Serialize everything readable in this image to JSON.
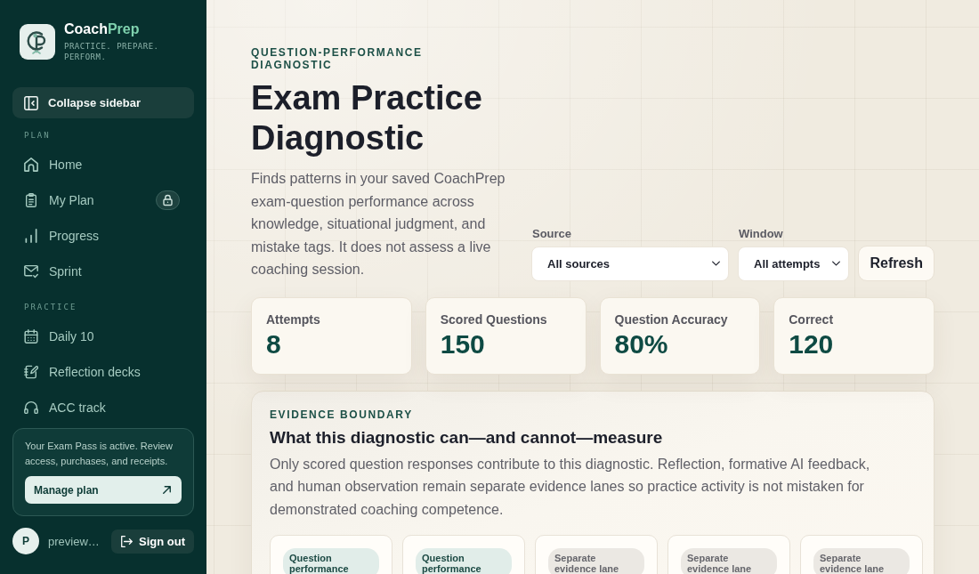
{
  "sidebar": {
    "brand": {
      "name_start": "Coach",
      "name_accent": "Prep",
      "tagline": "PRACTICE. PREPARE. PERFORM."
    },
    "collapse_button": {
      "label": "Collapse sidebar"
    },
    "sections": [
      {
        "heading": "PLAN",
        "items": [
          {
            "label": "Home",
            "selected": false,
            "locked": false
          },
          {
            "label": "My Plan",
            "selected": false,
            "locked": true
          },
          {
            "label": "Progress",
            "selected": false,
            "locked": false
          },
          {
            "label": "Sprint",
            "selected": false,
            "locked": false
          }
        ]
      },
      {
        "heading": "PRACTICE",
        "items": [
          {
            "label": "Daily 10",
            "selected": false,
            "locked": false
          },
          {
            "label": "Reflection decks",
            "selected": false,
            "locked": false
          },
          {
            "label": "ACC track",
            "selected": false,
            "locked": false
          }
        ]
      }
    ],
    "plan_card": {
      "text": "Your Exam Pass is active. Review access, purchases, and receipts.",
      "button": "Manage plan"
    },
    "user": {
      "avatar": "P",
      "name": "preview…"
    },
    "sign_out": "Sign out"
  },
  "header": {
    "eyebrow": "QUESTION-PERFORMANCE DIAGNOSTIC",
    "title": "Exam Practice Diagnostic",
    "description": "Finds patterns in your saved CoachPrep exam-question performance across knowledge, situational judgment, and mistake tags. It does not assess a live coaching session."
  },
  "filters": [
    {
      "label": "Source",
      "value": "All sources"
    },
    {
      "label": "Window",
      "value": "All attempts"
    }
  ],
  "refresh_button": "Refresh",
  "stats": [
    {
      "label": "Attempts",
      "value": "8"
    },
    {
      "label": "Scored Questions",
      "value": "150"
    },
    {
      "label": "Question Accuracy",
      "value": "80%"
    },
    {
      "label": "Correct",
      "value": "120"
    }
  ],
  "evidence_panel": {
    "eyebrow": "EVIDENCE BOUNDARY",
    "title": "What this diagnostic can—and cannot—measure",
    "text": "Only scored question responses contribute to this diagnostic. Reflection, formative AI feedback, and human observation remain separate evidence lanes so practice activity is not mistaken for demonstrated coaching competence.",
    "lanes": [
      {
        "kind": "question",
        "tag": "Question performance"
      },
      {
        "kind": "question",
        "tag": "Question performance"
      },
      {
        "kind": "separate",
        "tag": "Separate evidence lane"
      },
      {
        "kind": "separate",
        "tag": "Separate evidence lane"
      },
      {
        "kind": "separate",
        "tag": "Separate evidence lane"
      }
    ]
  }
}
